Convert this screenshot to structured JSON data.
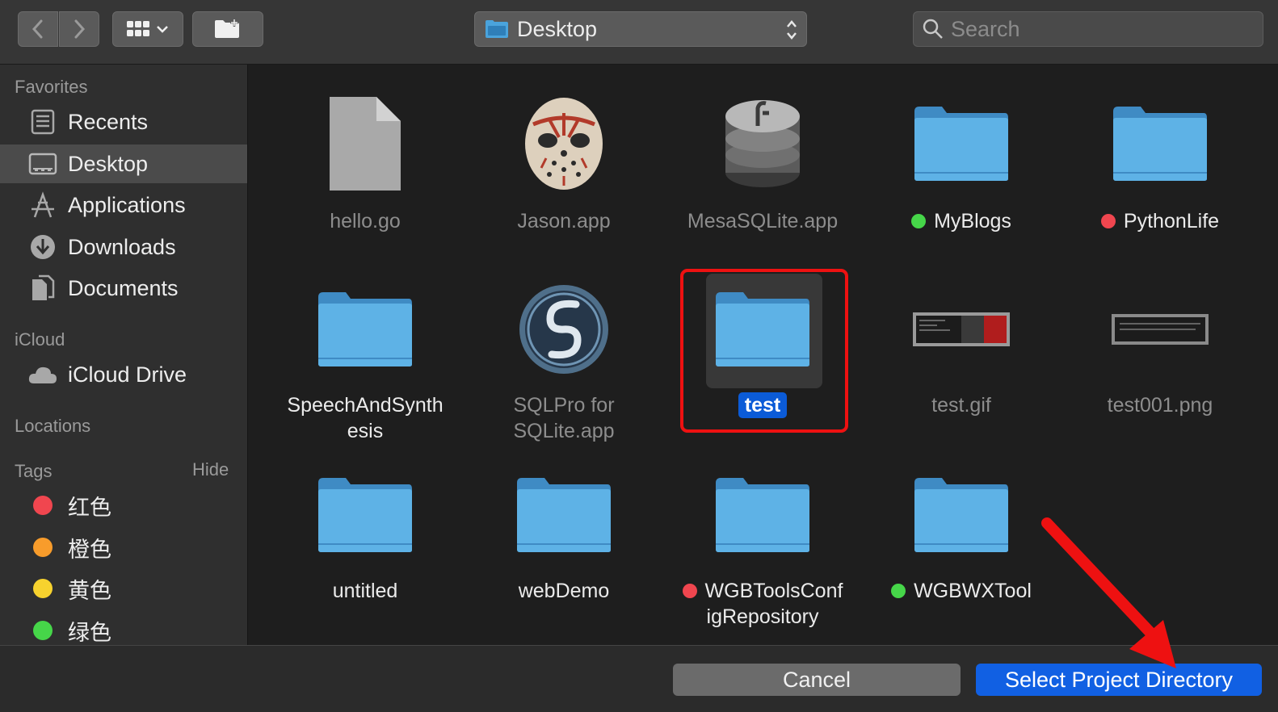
{
  "toolbar": {
    "path_label": "Desktop",
    "search_placeholder": "Search"
  },
  "sidebar": {
    "favorites_heading": "Favorites",
    "favorites": [
      {
        "label": "Recents",
        "icon": "recents-icon"
      },
      {
        "label": "Desktop",
        "icon": "desktop-icon",
        "selected": true
      },
      {
        "label": "Applications",
        "icon": "applications-icon"
      },
      {
        "label": "Downloads",
        "icon": "downloads-icon"
      },
      {
        "label": "Documents",
        "icon": "documents-icon"
      }
    ],
    "icloud_heading": "iCloud",
    "icloud": [
      {
        "label": "iCloud Drive",
        "icon": "cloud-icon"
      }
    ],
    "locations_heading": "Locations",
    "tags_heading": "Tags",
    "tags_hide": "Hide",
    "tags": [
      {
        "label": "红色",
        "color": "#f0464f"
      },
      {
        "label": "橙色",
        "color": "#f89c2b"
      },
      {
        "label": "黄色",
        "color": "#f7d22e"
      },
      {
        "label": "绿色",
        "color": "#46d649"
      }
    ]
  },
  "files": [
    {
      "name": "hello.go",
      "kind": "document",
      "dimmed": true
    },
    {
      "name": "Jason.app",
      "kind": "app-mask",
      "dimmed": true
    },
    {
      "name": "MesaSQLite.app",
      "kind": "app-database",
      "dimmed": true
    },
    {
      "name": "MyBlogs",
      "kind": "folder",
      "tag_color": "#46d649"
    },
    {
      "name": "PythonLife",
      "kind": "folder",
      "tag_color": "#f0464f"
    },
    {
      "name": "SpeechAndSynth",
      "name2": "esis",
      "kind": "folder"
    },
    {
      "name": "SQLPro for",
      "name2": "SQLite.app",
      "kind": "app-sqlpro",
      "dimmed": true
    },
    {
      "name": "test",
      "kind": "folder",
      "selected": true
    },
    {
      "name": "test.gif",
      "kind": "image-gif",
      "dimmed": true
    },
    {
      "name": "test001.png",
      "kind": "image-png",
      "dimmed": true
    },
    {
      "name": "untitled",
      "kind": "folder"
    },
    {
      "name": "webDemo",
      "kind": "folder"
    },
    {
      "name": "WGBToolsConf",
      "name2": "igRepository",
      "kind": "folder",
      "tag_color": "#f0464f"
    },
    {
      "name": "WGBWXTool",
      "kind": "folder",
      "tag_color": "#46d649"
    }
  ],
  "buttons": {
    "cancel": "Cancel",
    "primary": "Select Project Directory"
  },
  "colors": {
    "accent": "#1160e3",
    "folder": "#4aa3dc",
    "annotation": "#ee1111"
  }
}
